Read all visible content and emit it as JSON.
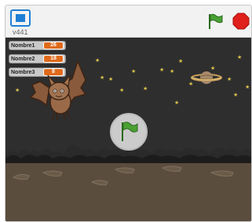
{
  "player": {
    "version_label": "v441",
    "accent_flag_color": "#3f8c2e",
    "stop_color": "#e0201a"
  },
  "stage": {
    "variables": [
      {
        "name": "Nombre1",
        "value": "26"
      },
      {
        "name": "Nombre2",
        "value": "18"
      },
      {
        "name": "Nombre3",
        "value": "8"
      }
    ],
    "sprites": [
      "bat-sprite",
      "planet-sprite",
      "green-flag-start-button"
    ],
    "ground_color": "#5b4d3e",
    "sky_color": "#2e2e2e"
  }
}
